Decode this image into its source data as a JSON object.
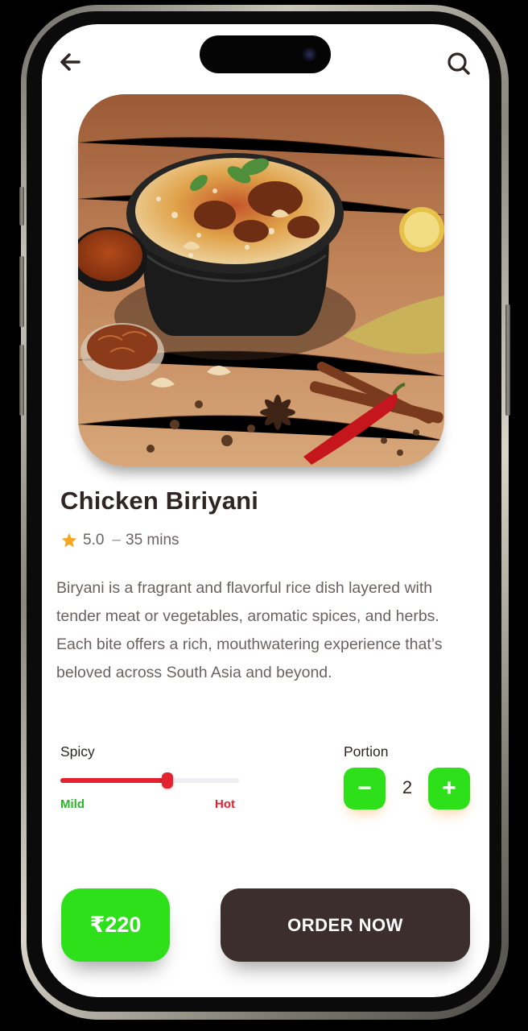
{
  "header": {
    "back_icon": "arrow-left-icon",
    "search_icon": "search-icon"
  },
  "product": {
    "image_description_icon": "biryani-photo",
    "title": "Chicken Biriyani",
    "rating": "5.0",
    "separator": "–",
    "time": "35 mins",
    "description": "Biryani is a fragrant and flavorful rice dish layered with tender meat or vegetables, aromatic spices, and herbs. Each bite offers a rich, mouthwatering experience that’s beloved across South Asia and beyond."
  },
  "spicy": {
    "label": "Spicy",
    "min_label": "Mild",
    "max_label": "Hot",
    "level": 0.6
  },
  "portion": {
    "label": "Portion",
    "minus": "−",
    "plus": "+",
    "quantity": "2"
  },
  "footer": {
    "price": "₹220",
    "order_label": "ORDER NOW"
  },
  "colors": {
    "accent_green": "#2ee01a",
    "spicy_red": "#e3212f",
    "dark_brown": "#3b2e2c",
    "star": "#f5a623"
  }
}
